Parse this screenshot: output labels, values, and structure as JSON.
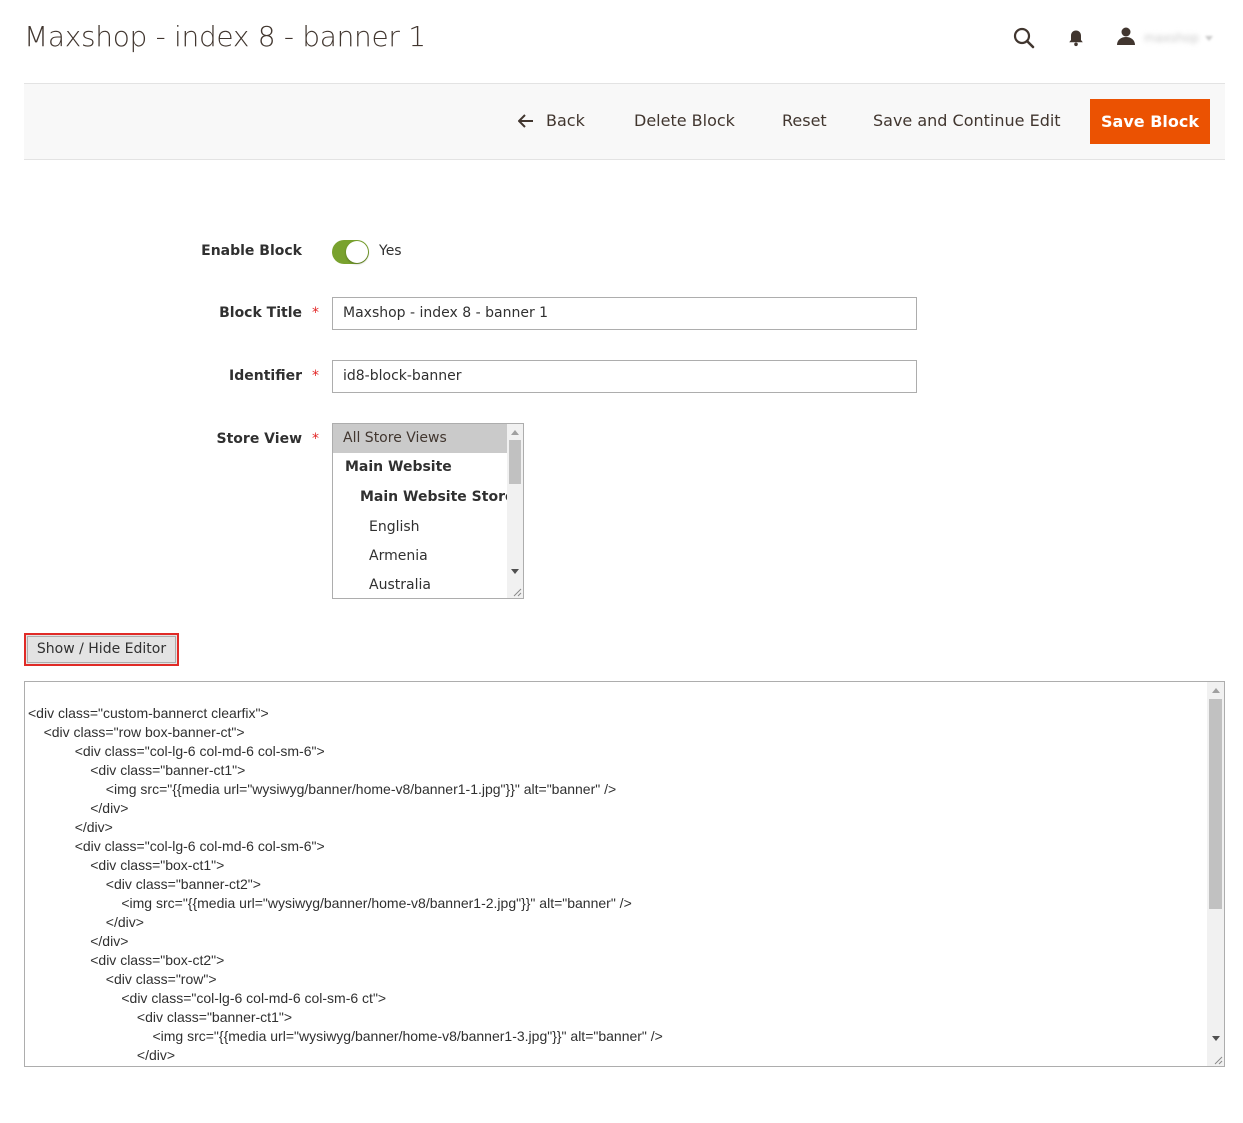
{
  "page": {
    "title": "Maxshop - index 8 - banner 1"
  },
  "header": {
    "user_name": "maxshop",
    "icons": [
      "search-icon",
      "bell-icon",
      "user-icon"
    ]
  },
  "action_bar": {
    "back_label": "Back",
    "delete_label": "Delete Block",
    "reset_label": "Reset",
    "save_continue_label": "Save and Continue Edit",
    "save_label": "Save Block"
  },
  "form": {
    "enable_block": {
      "label": "Enable Block",
      "state_text": "Yes",
      "enabled": true
    },
    "block_title": {
      "label": "Block Title",
      "required_mark": "*",
      "value": "Maxshop - index 8 - banner 1"
    },
    "identifier": {
      "label": "Identifier",
      "required_mark": "*",
      "value": "id8-block-banner"
    },
    "store_view": {
      "label": "Store View",
      "required_mark": "*",
      "options": [
        {
          "text": "All Store Views",
          "selected": true
        },
        {
          "text": "Main Website",
          "bold": true
        },
        {
          "text": "Main Website Store",
          "bold": true
        },
        {
          "text": "English"
        },
        {
          "text": "Armenia"
        },
        {
          "text": "Australia"
        }
      ]
    }
  },
  "editor": {
    "toggle_label": "Show / Hide Editor",
    "content": "<div class=\"custom-bannerct clearfix\">\n\t<div class=\"row box-banner-ct\">\n\t\t\t<div class=\"col-lg-6 col-md-6 col-sm-6\">\n\t\t\t\t<div class=\"banner-ct1\">\n\t\t\t\t\t<img src=\"{{media url=\"wysiwyg/banner/home-v8/banner1-1.jpg\"}}\" alt=\"banner\" />\n\t\t\t\t</div>\n\t\t\t</div>\n\t\t\t<div class=\"col-lg-6 col-md-6 col-sm-6\">\n\t\t\t\t<div class=\"box-ct1\">\n\t\t\t\t\t<div class=\"banner-ct2\">\n\t\t\t\t\t\t<img src=\"{{media url=\"wysiwyg/banner/home-v8/banner1-2.jpg\"}}\" alt=\"banner\" />\n\t\t\t\t\t</div>\n\t\t\t\t</div>\n\t\t\t\t<div class=\"box-ct2\">\n\t\t\t\t\t<div class=\"row\">\n\t\t\t\t\t\t<div class=\"col-lg-6 col-md-6 col-sm-6 ct\">\n\t\t\t\t\t\t\t<div class=\"banner-ct1\">\n\t\t\t\t\t\t\t\t<img src=\"{{media url=\"wysiwyg/banner/home-v8/banner1-3.jpg\"}}\" alt=\"banner\" />\n\t\t\t\t\t\t\t</div>"
  },
  "colors": {
    "primary_button": "#eb5202",
    "toggle_on": "#79a22e",
    "required": "#e22626",
    "highlight_border": "#e02b27"
  }
}
